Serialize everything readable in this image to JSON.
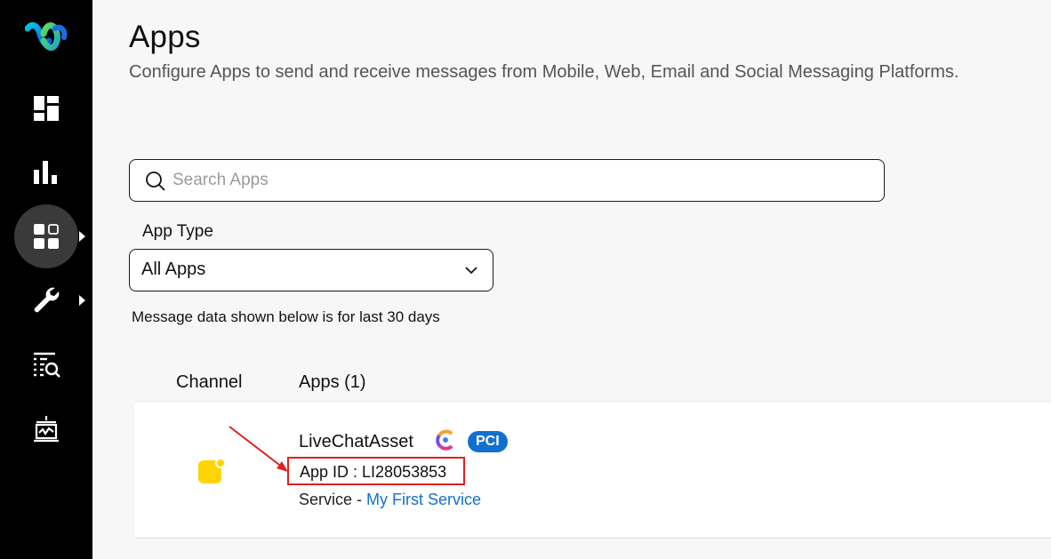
{
  "sidebar": {
    "items": [
      {
        "name": "logo",
        "icon": "webex-logo-icon"
      },
      {
        "name": "dashboard",
        "icon": "dashboard-icon"
      },
      {
        "name": "analytics",
        "icon": "bar-chart-icon"
      },
      {
        "name": "apps",
        "icon": "apps-grid-icon",
        "active": true
      },
      {
        "name": "settings",
        "icon": "wrench-icon"
      },
      {
        "name": "logs",
        "icon": "list-search-icon"
      },
      {
        "name": "monitor",
        "icon": "cake-monitor-icon"
      }
    ]
  },
  "header": {
    "title": "Apps",
    "subtitle": "Configure Apps to send and receive messages from Mobile, Web, Email and Social Messaging Platforms."
  },
  "search": {
    "placeholder": "Search Apps",
    "value": ""
  },
  "filter": {
    "label": "App Type",
    "selected": "All Apps"
  },
  "note": "Message data shown below is for last 30 days",
  "table": {
    "columns": [
      "Channel",
      "Apps (1)"
    ],
    "rows": [
      {
        "channel_icon": "livechat-icon",
        "name": "LiveChatAsset",
        "badge": "PCI",
        "app_id": "App ID : LI28053853",
        "service_prefix": "Service - ",
        "service_link": "My First Service"
      }
    ]
  },
  "colors": {
    "sidebar_bg": "#000000",
    "accent_blue": "#1170cf",
    "highlight_red": "#e0201f",
    "channel_yellow": "#ffd400"
  }
}
